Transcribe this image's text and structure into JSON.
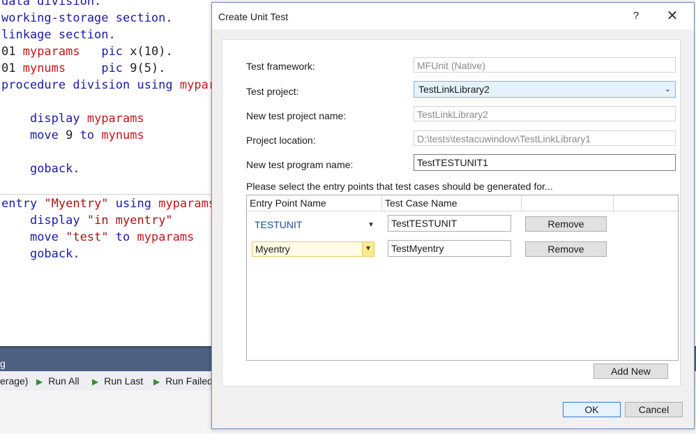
{
  "editor": {
    "lines": [
      {
        "kw1": "data division."
      },
      {
        "kw1": "working-storage section."
      },
      {
        "kw1": "linkage section."
      },
      {
        "num": "01 ",
        "id": "myparams",
        "pad": "   ",
        "pic": "pic ",
        "val": "x(10)."
      },
      {
        "num": "01 ",
        "id": "mynums",
        "pad": "     ",
        "pic": "pic ",
        "val": "9(5)."
      },
      {
        "kw1": "procedure division using ",
        "id": "mypar"
      },
      {
        "ind": "    ",
        "kw1": "display ",
        "id": "myparams"
      },
      {
        "ind": "    ",
        "kw1": "move ",
        "tx": "9 ",
        "kw2": "to ",
        "id": "mynums"
      },
      {
        "ind": "    ",
        "kw1": "goback."
      },
      {
        "kw1": "entry ",
        "str": "\"Myentry\" ",
        "kw2": "using ",
        "id": "myparams"
      },
      {
        "ind": "    ",
        "kw1": "display ",
        "str": "\"in myentry\""
      },
      {
        "ind": "    ",
        "kw1": "move ",
        "str": "\"test\" ",
        "kw2": "to ",
        "id": "myparams"
      },
      {
        "ind": "    ",
        "kw1": "goback."
      }
    ]
  },
  "test_explorer": {
    "header": "g",
    "coverage_fragment": "erage)",
    "run_all": "Run All",
    "run_last": "Run Last",
    "run_failed": "Run Failed"
  },
  "dialog": {
    "title": "Create Unit Test",
    "help": "?",
    "close": "✕",
    "test_framework_label": "Test framework:",
    "test_framework_value": "MFUnit (Native)",
    "test_project_label": "Test project:",
    "test_project_value": "TestLinkLibrary2",
    "new_test_project_name_label": "New test project name:",
    "new_test_project_name_value": "TestLinkLibrary2",
    "project_location_label": "Project location:",
    "project_location_value": "D:\\tests\\testacuwindow\\TestLinkLibrary1",
    "new_test_program_name_label": "New test program name:",
    "new_test_program_name_value": "TestTESTUNIT1",
    "instructions": "Please select the entry points that test cases should be generated for...",
    "grid": {
      "col_entry_point": "Entry Point Name",
      "col_test_case": "Test Case Name",
      "rows": [
        {
          "entry_point": "TESTUNIT",
          "test_case": "TestTESTUNIT",
          "remove": "Remove"
        },
        {
          "entry_point": "Myentry",
          "test_case": "TestMyentry",
          "remove": "Remove"
        }
      ]
    },
    "add_new": "Add New",
    "ok": "OK",
    "cancel": "Cancel"
  }
}
